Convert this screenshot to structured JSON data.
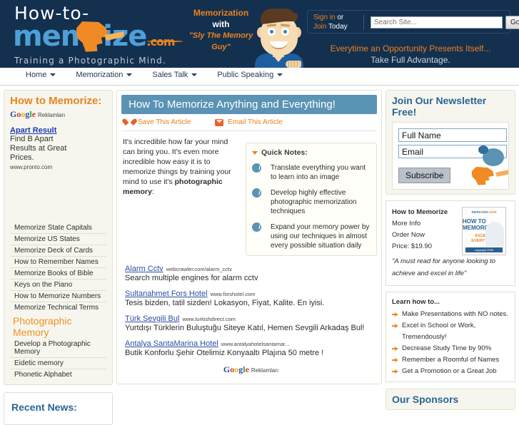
{
  "header": {
    "logo": {
      "line1": "How-to-",
      "word": "mem",
      "word2": "rize",
      "com": ".com",
      "tagline": "Training a Photographic Mind."
    },
    "memo_tag": {
      "l1": "Memorization",
      "l2": "with",
      "l3": "\"Sly The Memory Guy\""
    },
    "signin": {
      "sign_in": "Sign in",
      "or": " or",
      "join": "Join",
      "today": " Today"
    },
    "search": {
      "placeholder": "Search Site...",
      "value": "",
      "go": "Go"
    },
    "slogan": {
      "l1": "Everytime an Opportunity Presents Itself...",
      "l2": "Take Full Advantage."
    }
  },
  "nav": {
    "items": [
      {
        "label": "Home"
      },
      {
        "label": "Memorization"
      },
      {
        "label": "Sales Talk"
      },
      {
        "label": "Public Speaking"
      }
    ]
  },
  "left": {
    "title": "How to Memorize:",
    "google_ads_label": "Reklamları",
    "ad": {
      "title": "Apart Result",
      "line1": "Find B Apart",
      "line2": "Results at Great",
      "line3": "Prices.",
      "url": "www.pronto.com"
    },
    "links": [
      "Memorize State Capitals",
      "Memorize US States",
      "Memorize Deck of Cards",
      "How to Remember Names",
      "Memorize Books of Bible",
      "Keys on the Piano",
      "How to Memorize Numbers",
      "Memorize Technical Terms"
    ],
    "section_title": "Photographic Memory",
    "links2": [
      "Develop a Photographic Memory",
      "Eidetic memory",
      "Phonetic Alphabet"
    ],
    "news_title": "Recent News:"
  },
  "article": {
    "title": "How To Memorize Anything and Everything!",
    "save_label": "Save This Article",
    "email_label": "Email This Article",
    "body_part1": "It's incredible how far your mind can bring you. It's even more incredible how easy it is to memorize things by training your mind to use it's ",
    "body_bold": "photographic memory",
    "body_part2": ":",
    "quick_notes_title": "Quick Notes:",
    "quick_notes": [
      "Translate everything you want to learn into an image",
      "Develop highly effective photographic memorization techniques",
      "Expand your memory power by using our techniques in almost every possible situation daily"
    ],
    "ads": [
      {
        "title": "Alarm Cctv",
        "url": "webcrawler.com/alarm_cctv",
        "desc": "Search multiple engines for alarm cctv"
      },
      {
        "title": "Sultanahmet Fors Hotel",
        "url": "www.forshotel.com",
        "desc": "Tesis bizden, tatil sizden! Lokasyon, Fiyat, Kalite. En iyisi."
      },
      {
        "title": "Türk Sevgili Bul",
        "url": "www.turkishdirect.com",
        "desc": "Yurtdışı Türklerin Buluştuğu Siteye Katıl, Hemen Sevgili Arkadaş Bul!"
      },
      {
        "title": "Antalya SantaMarina Hotel",
        "url": "www.antalyahotelsantamar...",
        "desc": "Butik Konforlu Şehir Otelimiz Konyaaltı Plajına 50 metre !"
      }
    ],
    "google_ads_label": "Reklamları"
  },
  "right": {
    "newsletter_title": "Join Our Newsletter Free!",
    "name_value": "Full Name",
    "email_value": "Email",
    "subscribe_label": "Subscribe",
    "book": {
      "title": "How to Memorize",
      "more_info": "More Info",
      "order_now": "Order Now",
      "price": "Price: $19.90",
      "quote": "\"A must read for anyone looking to achieve and excel in life\"",
      "cover_logo": "memorize",
      "cover_logo_suffix": ".com",
      "cover_title": "HOW TO MEMORIZE",
      "cover_sub": "EXCEL IN EVERYTHING",
      "cover_bar": "copyright 2009"
    },
    "learn_title": "Learn how to...",
    "learn_items": [
      "Make Presentations with NO notes.",
      "Excel in School or Work, Tremendously!",
      "Decrease Study Time by 90%",
      "Remember a Roomful of Names",
      "Get a Promotion or a Great Job"
    ],
    "sponsors_title": "Our Sponsors"
  },
  "colors": {
    "header_bg": "#14304f",
    "orange": "#e8821e",
    "blue_link": "#2b4ea2",
    "article_head": "#5b93b5"
  }
}
